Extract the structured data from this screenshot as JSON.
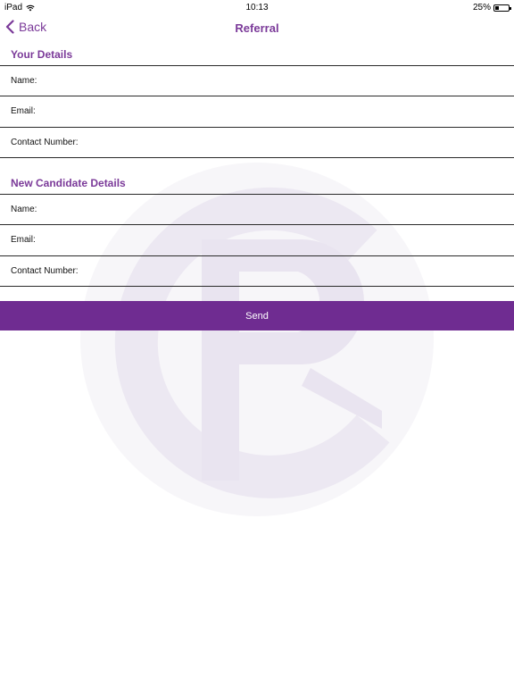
{
  "status_bar": {
    "device": "iPad",
    "time": "10:13",
    "battery": "25%",
    "wifi_icon": "wifi-icon",
    "battery_icon": "battery-icon"
  },
  "nav": {
    "back_label": "Back",
    "title": "Referral",
    "back_icon": "chevron-left-icon"
  },
  "your_details": {
    "header": "Your Details",
    "fields": [
      {
        "label": "Name:",
        "value": ""
      },
      {
        "label": "Email:",
        "value": ""
      },
      {
        "label": "Contact Number:",
        "value": ""
      }
    ]
  },
  "new_candidate": {
    "header": "New Candidate Details",
    "fields": [
      {
        "label": "Name:",
        "value": ""
      },
      {
        "label": "Email:",
        "value": ""
      },
      {
        "label": "Contact Number:",
        "value": ""
      }
    ]
  },
  "send_label": "Send",
  "watermark": {
    "text": "CP",
    "icon": "cp-logo-watermark"
  },
  "colors": {
    "accent": "#7b3a99",
    "button_bg": "#6f2c91",
    "button_text": "#ffffff",
    "divider": "#2a2a2a",
    "watermark": "#ece8f2"
  }
}
